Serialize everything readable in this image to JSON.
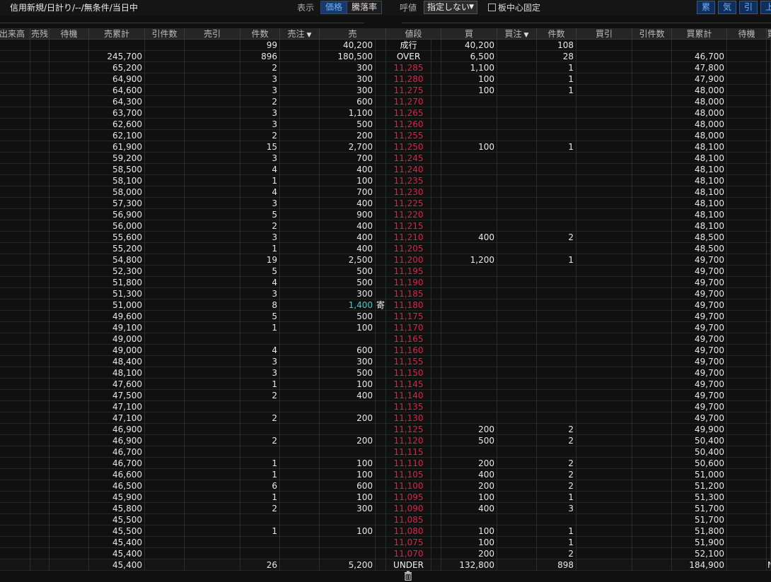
{
  "toolbar": {
    "title": "信用新規/日計り/--/無条件/当日中",
    "display_label": "表示",
    "display_tabs": [
      "価格",
      "騰落率"
    ],
    "tick_label": "呼値",
    "tick_select": "指定しない",
    "center_fix_label": "板中心固定",
    "center_fix_checked": false,
    "right_buttons": [
      "累",
      "気",
      "引",
      "上"
    ]
  },
  "columns": [
    "出来高",
    "売残",
    "待機",
    "売累計",
    "引件数",
    "売引",
    "件数",
    "売注",
    "売",
    "値段",
    "買",
    "買注",
    "件数",
    "買引",
    "引件数",
    "買累計",
    "待機",
    "買"
  ],
  "sort_marks": {
    "sell_order": "▼",
    "buy_order": "▼"
  },
  "colors": {
    "price": "#e0204a",
    "highlight": "#2ad4cc",
    "background": "#101010"
  },
  "yori_mark": "寄",
  "rows": [
    {
      "sell_cum": "",
      "sell_cnt": "99",
      "sell": "40,200",
      "price": "成行",
      "buy": "40,200",
      "buy_cnt": "108",
      "buy_cum": ""
    },
    {
      "sell_cum": "245,700",
      "sell_cnt": "896",
      "sell": "180,500",
      "price": "OVER",
      "buy": "6,500",
      "buy_cnt": "28",
      "buy_cum": "46,700"
    },
    {
      "sell_cum": "65,200",
      "sell_cnt": "2",
      "sell": "300",
      "price": "11,285",
      "buy": "1,100",
      "buy_cnt": "1",
      "buy_cum": "47,800"
    },
    {
      "sell_cum": "64,900",
      "sell_cnt": "3",
      "sell": "300",
      "price": "11,280",
      "buy": "100",
      "buy_cnt": "1",
      "buy_cum": "47,900"
    },
    {
      "sell_cum": "64,600",
      "sell_cnt": "3",
      "sell": "300",
      "price": "11,275",
      "buy": "100",
      "buy_cnt": "1",
      "buy_cum": "48,000"
    },
    {
      "sell_cum": "64,300",
      "sell_cnt": "2",
      "sell": "600",
      "price": "11,270",
      "buy": "",
      "buy_cnt": "",
      "buy_cum": "48,000"
    },
    {
      "sell_cum": "63,700",
      "sell_cnt": "3",
      "sell": "1,100",
      "price": "11,265",
      "buy": "",
      "buy_cnt": "",
      "buy_cum": "48,000"
    },
    {
      "sell_cum": "62,600",
      "sell_cnt": "3",
      "sell": "500",
      "price": "11,260",
      "buy": "",
      "buy_cnt": "",
      "buy_cum": "48,000"
    },
    {
      "sell_cum": "62,100",
      "sell_cnt": "2",
      "sell": "200",
      "price": "11,255",
      "buy": "",
      "buy_cnt": "",
      "buy_cum": "48,000"
    },
    {
      "sell_cum": "61,900",
      "sell_cnt": "15",
      "sell": "2,700",
      "price": "11,250",
      "buy": "100",
      "buy_cnt": "1",
      "buy_cum": "48,100"
    },
    {
      "sell_cum": "59,200",
      "sell_cnt": "3",
      "sell": "700",
      "price": "11,245",
      "buy": "",
      "buy_cnt": "",
      "buy_cum": "48,100"
    },
    {
      "sell_cum": "58,500",
      "sell_cnt": "4",
      "sell": "400",
      "price": "11,240",
      "buy": "",
      "buy_cnt": "",
      "buy_cum": "48,100"
    },
    {
      "sell_cum": "58,100",
      "sell_cnt": "1",
      "sell": "100",
      "price": "11,235",
      "buy": "",
      "buy_cnt": "",
      "buy_cum": "48,100"
    },
    {
      "sell_cum": "58,000",
      "sell_cnt": "4",
      "sell": "700",
      "price": "11,230",
      "buy": "",
      "buy_cnt": "",
      "buy_cum": "48,100"
    },
    {
      "sell_cum": "57,300",
      "sell_cnt": "3",
      "sell": "400",
      "price": "11,225",
      "buy": "",
      "buy_cnt": "",
      "buy_cum": "48,100"
    },
    {
      "sell_cum": "56,900",
      "sell_cnt": "5",
      "sell": "900",
      "price": "11,220",
      "buy": "",
      "buy_cnt": "",
      "buy_cum": "48,100"
    },
    {
      "sell_cum": "56,000",
      "sell_cnt": "2",
      "sell": "400",
      "price": "11,215",
      "buy": "",
      "buy_cnt": "",
      "buy_cum": "48,100"
    },
    {
      "sell_cum": "55,600",
      "sell_cnt": "3",
      "sell": "400",
      "price": "11,210",
      "buy": "400",
      "buy_cnt": "2",
      "buy_cum": "48,500"
    },
    {
      "sell_cum": "55,200",
      "sell_cnt": "1",
      "sell": "400",
      "price": "11,205",
      "buy": "",
      "buy_cnt": "",
      "buy_cum": "48,500"
    },
    {
      "sell_cum": "54,800",
      "sell_cnt": "19",
      "sell": "2,500",
      "price": "11,200",
      "buy": "1,200",
      "buy_cnt": "1",
      "buy_cum": "49,700"
    },
    {
      "sell_cum": "52,300",
      "sell_cnt": "5",
      "sell": "500",
      "price": "11,195",
      "buy": "",
      "buy_cnt": "",
      "buy_cum": "49,700"
    },
    {
      "sell_cum": "51,800",
      "sell_cnt": "4",
      "sell": "500",
      "price": "11,190",
      "buy": "",
      "buy_cnt": "",
      "buy_cum": "49,700"
    },
    {
      "sell_cum": "51,300",
      "sell_cnt": "3",
      "sell": "300",
      "price": "11,185",
      "buy": "",
      "buy_cnt": "",
      "buy_cum": "49,700"
    },
    {
      "sell_cum": "51,000",
      "sell_cnt": "8",
      "sell": "1,400",
      "price": "11,180",
      "buy": "",
      "buy_cnt": "",
      "buy_cum": "49,700",
      "highlight": true
    },
    {
      "sell_cum": "49,600",
      "sell_cnt": "5",
      "sell": "500",
      "price": "11,175",
      "buy": "",
      "buy_cnt": "",
      "buy_cum": "49,700"
    },
    {
      "sell_cum": "49,100",
      "sell_cnt": "1",
      "sell": "100",
      "price": "11,170",
      "buy": "",
      "buy_cnt": "",
      "buy_cum": "49,700"
    },
    {
      "sell_cum": "49,000",
      "sell_cnt": "",
      "sell": "",
      "price": "11,165",
      "buy": "",
      "buy_cnt": "",
      "buy_cum": "49,700"
    },
    {
      "sell_cum": "49,000",
      "sell_cnt": "4",
      "sell": "600",
      "price": "11,160",
      "buy": "",
      "buy_cnt": "",
      "buy_cum": "49,700"
    },
    {
      "sell_cum": "48,400",
      "sell_cnt": "3",
      "sell": "300",
      "price": "11,155",
      "buy": "",
      "buy_cnt": "",
      "buy_cum": "49,700"
    },
    {
      "sell_cum": "48,100",
      "sell_cnt": "3",
      "sell": "500",
      "price": "11,150",
      "buy": "",
      "buy_cnt": "",
      "buy_cum": "49,700"
    },
    {
      "sell_cum": "47,600",
      "sell_cnt": "1",
      "sell": "100",
      "price": "11,145",
      "buy": "",
      "buy_cnt": "",
      "buy_cum": "49,700"
    },
    {
      "sell_cum": "47,500",
      "sell_cnt": "2",
      "sell": "400",
      "price": "11,140",
      "buy": "",
      "buy_cnt": "",
      "buy_cum": "49,700"
    },
    {
      "sell_cum": "47,100",
      "sell_cnt": "",
      "sell": "",
      "price": "11,135",
      "buy": "",
      "buy_cnt": "",
      "buy_cum": "49,700"
    },
    {
      "sell_cum": "47,100",
      "sell_cnt": "2",
      "sell": "200",
      "price": "11,130",
      "buy": "",
      "buy_cnt": "",
      "buy_cum": "49,700"
    },
    {
      "sell_cum": "46,900",
      "sell_cnt": "",
      "sell": "",
      "price": "11,125",
      "buy": "200",
      "buy_cnt": "2",
      "buy_cum": "49,900"
    },
    {
      "sell_cum": "46,900",
      "sell_cnt": "2",
      "sell": "200",
      "price": "11,120",
      "buy": "500",
      "buy_cnt": "2",
      "buy_cum": "50,400"
    },
    {
      "sell_cum": "46,700",
      "sell_cnt": "",
      "sell": "",
      "price": "11,115",
      "buy": "",
      "buy_cnt": "",
      "buy_cum": "50,400"
    },
    {
      "sell_cum": "46,700",
      "sell_cnt": "1",
      "sell": "100",
      "price": "11,110",
      "buy": "200",
      "buy_cnt": "2",
      "buy_cum": "50,600"
    },
    {
      "sell_cum": "46,600",
      "sell_cnt": "1",
      "sell": "100",
      "price": "11,105",
      "buy": "400",
      "buy_cnt": "2",
      "buy_cum": "51,000"
    },
    {
      "sell_cum": "46,500",
      "sell_cnt": "6",
      "sell": "600",
      "price": "11,100",
      "buy": "200",
      "buy_cnt": "2",
      "buy_cum": "51,200"
    },
    {
      "sell_cum": "45,900",
      "sell_cnt": "1",
      "sell": "100",
      "price": "11,095",
      "buy": "100",
      "buy_cnt": "1",
      "buy_cum": "51,300"
    },
    {
      "sell_cum": "45,800",
      "sell_cnt": "2",
      "sell": "300",
      "price": "11,090",
      "buy": "400",
      "buy_cnt": "3",
      "buy_cum": "51,700"
    },
    {
      "sell_cum": "45,500",
      "sell_cnt": "",
      "sell": "",
      "price": "11,085",
      "buy": "",
      "buy_cnt": "",
      "buy_cum": "51,700"
    },
    {
      "sell_cum": "45,500",
      "sell_cnt": "1",
      "sell": "100",
      "price": "11,080",
      "buy": "100",
      "buy_cnt": "1",
      "buy_cum": "51,800"
    },
    {
      "sell_cum": "45,400",
      "sell_cnt": "",
      "sell": "",
      "price": "11,075",
      "buy": "100",
      "buy_cnt": "1",
      "buy_cum": "51,900"
    },
    {
      "sell_cum": "45,400",
      "sell_cnt": "",
      "sell": "",
      "price": "11,070",
      "buy": "200",
      "buy_cnt": "2",
      "buy_cum": "52,100"
    },
    {
      "sell_cum": "45,400",
      "sell_cnt": "26",
      "sell": "5,200",
      "price": "UNDER",
      "buy": "132,800",
      "buy_cnt": "898",
      "buy_cum": "184,900",
      "edge": "M"
    }
  ]
}
